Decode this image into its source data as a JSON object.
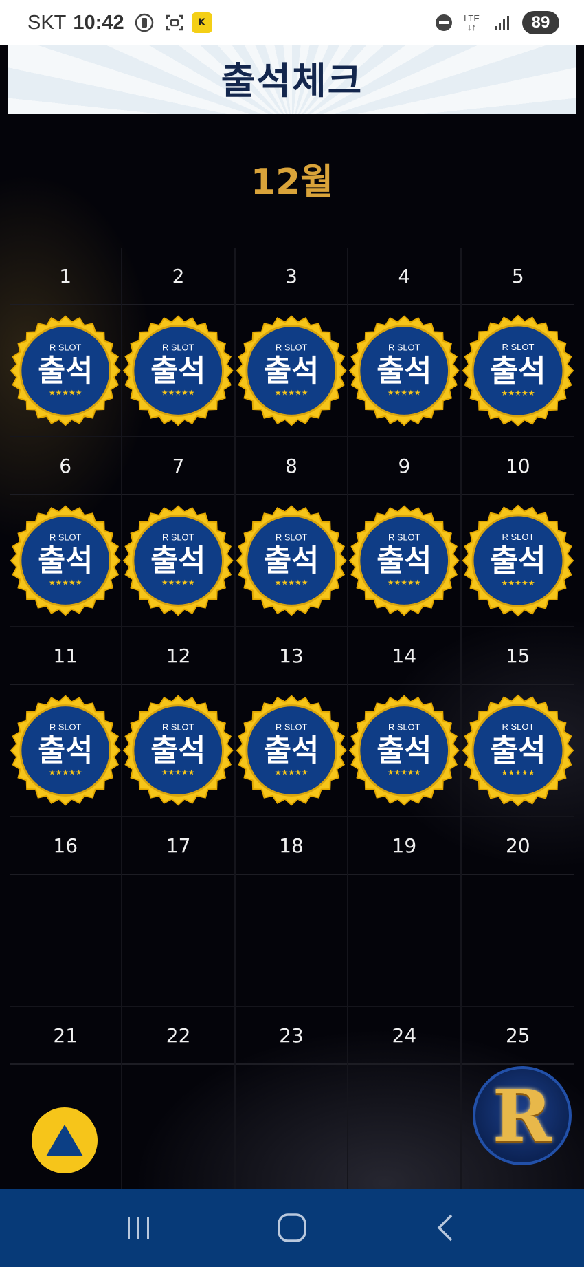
{
  "status_bar": {
    "carrier": "SKT",
    "time": "10:42",
    "network": "LTE",
    "battery": "89"
  },
  "banner": {
    "title": "출석체크"
  },
  "calendar": {
    "month": "12월",
    "stamp": {
      "brand": "R SLOT",
      "label": "출석",
      "stars": "★★★★★"
    },
    "weeks": [
      {
        "days": [
          "1",
          "2",
          "3",
          "4",
          "5"
        ],
        "stamped": [
          true,
          true,
          true,
          true,
          true
        ]
      },
      {
        "days": [
          "6",
          "7",
          "8",
          "9",
          "10"
        ],
        "stamped": [
          true,
          true,
          true,
          true,
          true
        ]
      },
      {
        "days": [
          "11",
          "12",
          "13",
          "14",
          "15"
        ],
        "stamped": [
          true,
          true,
          true,
          true,
          true
        ]
      },
      {
        "days": [
          "16",
          "17",
          "18",
          "19",
          "20"
        ],
        "stamped": [
          false,
          false,
          false,
          false,
          false
        ]
      },
      {
        "days": [
          "21",
          "22",
          "23",
          "24",
          "25"
        ],
        "stamped": [
          false,
          false,
          false,
          false,
          false
        ]
      }
    ]
  },
  "floating": {
    "r_logo": "R"
  },
  "colors": {
    "accent_gold": "#f6c51a",
    "month_gold": "#d9a33a",
    "stamp_blue": "#0f3d86",
    "nav_blue": "#073a78",
    "title_navy": "#13264d"
  }
}
